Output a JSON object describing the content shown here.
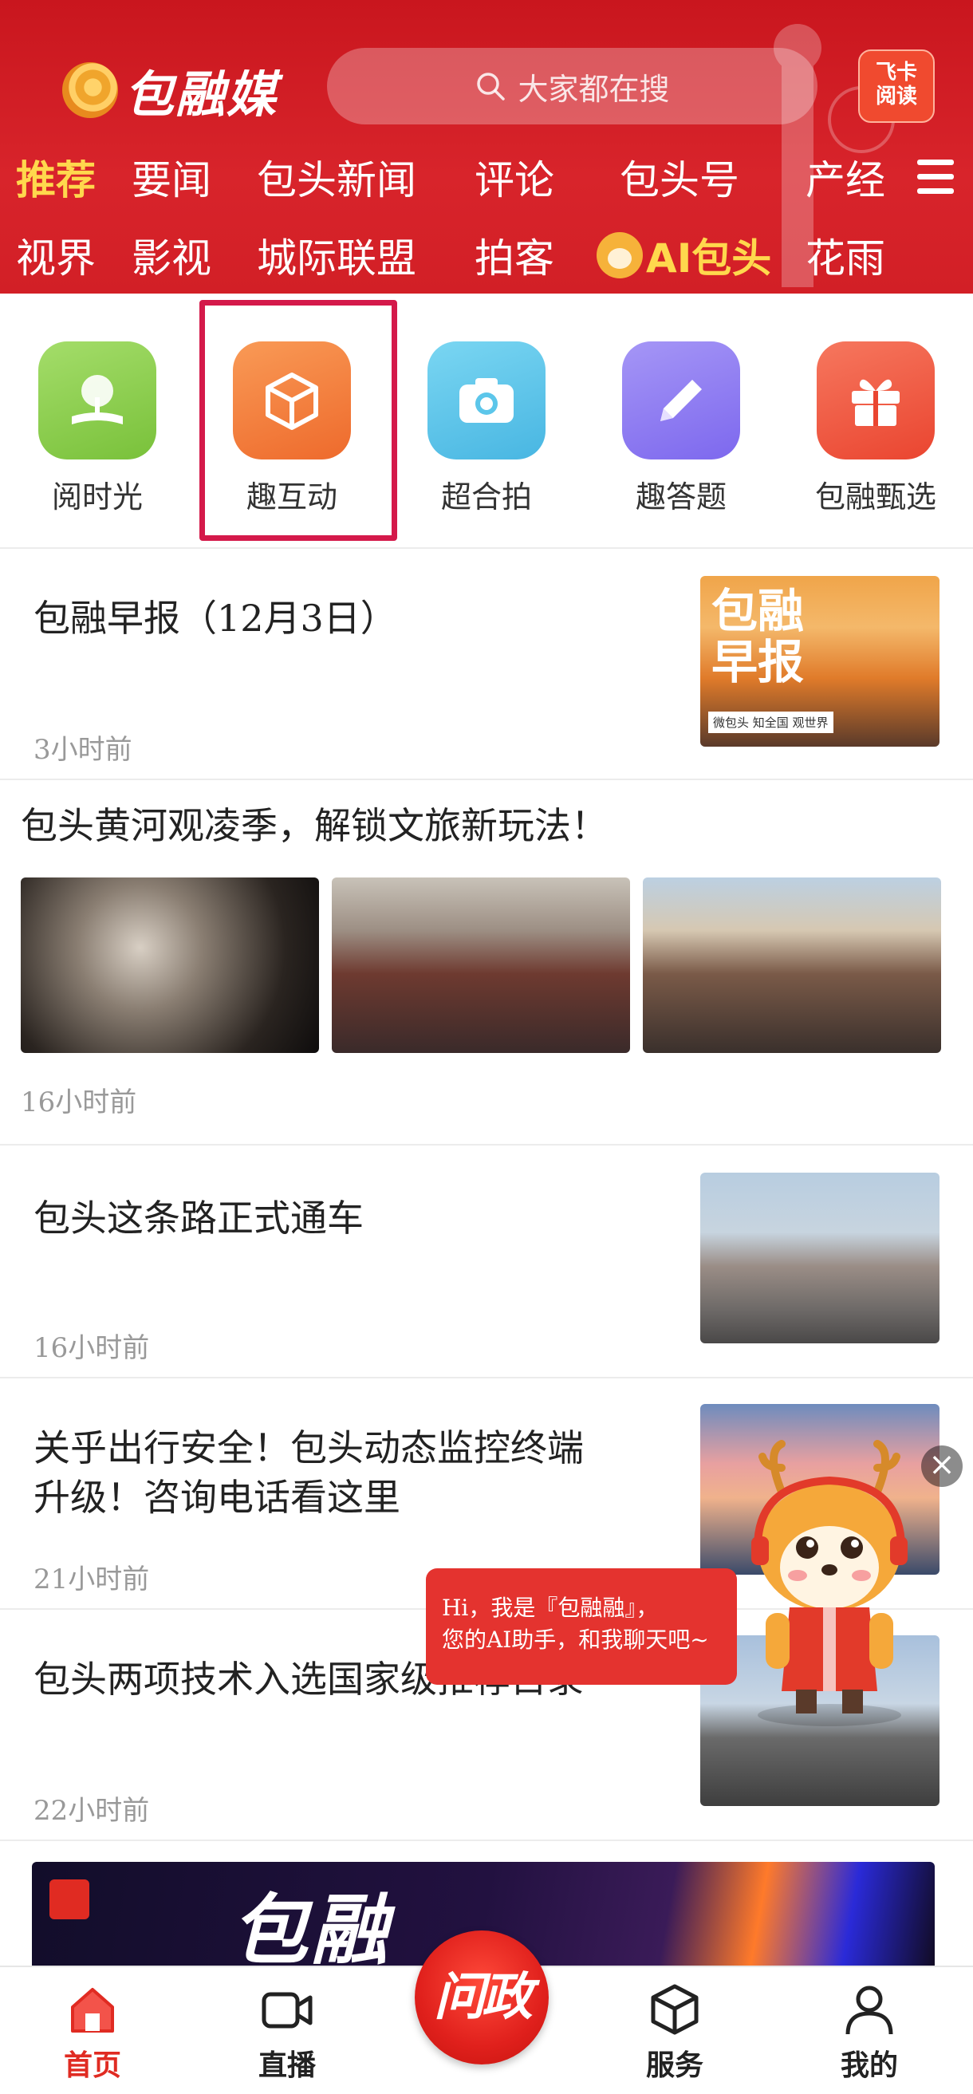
{
  "header": {
    "logo_text": "包融媒",
    "search_placeholder": "大家都在搜",
    "feika_label_1": "飞卡",
    "feika_label_2": "阅读",
    "tabs_row1": [
      "推荐",
      "要闻",
      "包头新闻",
      "评论",
      "包头号",
      "产经"
    ],
    "tabs_row2": [
      "视界",
      "影视",
      "城际联盟",
      "拍客",
      "AI包头",
      "花雨"
    ],
    "active_tab": "推荐"
  },
  "quick_links": [
    {
      "label": "阅时光",
      "icon": "book-tree-icon",
      "color": "#8ccf4d"
    },
    {
      "label": "趣互动",
      "icon": "cube-icon",
      "color": "#f27a3c"
    },
    {
      "label": "超合拍",
      "icon": "camera-icon",
      "color": "#5cc6ea"
    },
    {
      "label": "趣答题",
      "icon": "pencil-icon",
      "color": "#8f7cf2"
    },
    {
      "label": "包融甄选",
      "icon": "gift-icon",
      "color": "#f0563f"
    }
  ],
  "news": [
    {
      "title": "包融早报（12月3日）",
      "time": "3小时前",
      "thumb_text_1": "包融",
      "thumb_text_2": "早报",
      "thumb_caption": "微包头  知全国  观世界"
    },
    {
      "title": "包头黄河观凌季，解锁文旅新玩法！",
      "time": "16小时前"
    },
    {
      "title": "包头这条路正式通车",
      "time": "16小时前"
    },
    {
      "title_line1": "关乎出行安全！包头动态监控终端",
      "title_line2": "升级！咨询电话看这里",
      "time": "21小时前"
    },
    {
      "title": "包头两项技术入选国家级推荐目录",
      "time": "22小时前"
    }
  ],
  "assistant": {
    "line1": "Hi，我是『包融融』，",
    "line2": "您的AI助手，和我聊天吧~"
  },
  "banner": {
    "text": "包融"
  },
  "bottom_nav": {
    "home": "首页",
    "live": "直播",
    "center": "问政",
    "service": "服务",
    "mine": "我的"
  }
}
